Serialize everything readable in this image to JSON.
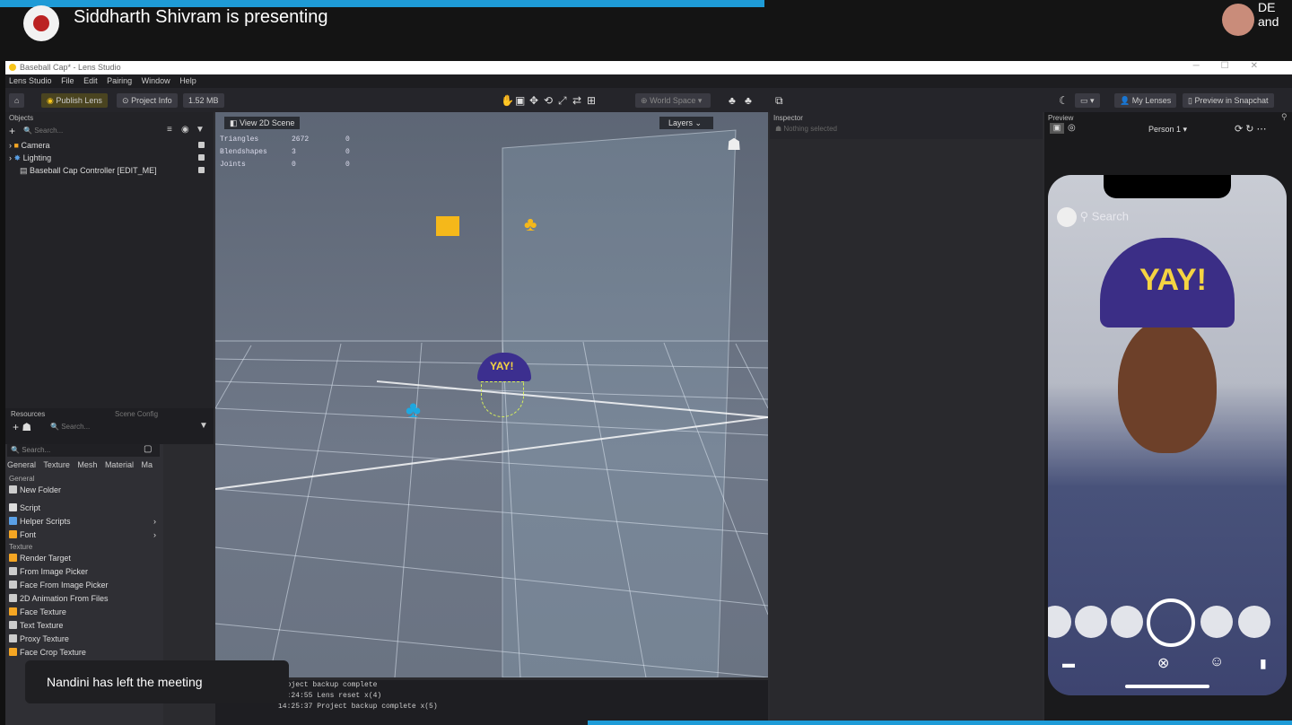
{
  "meeting": {
    "presenter_text": "Siddharth Shivram is presenting",
    "remote_user_label": "and",
    "toast": "Nandini has left the meeting"
  },
  "app": {
    "title": "Baseball Cap* - Lens Studio",
    "menu": [
      "Lens Studio",
      "File",
      "Edit",
      "Pairing",
      "Window",
      "Help"
    ],
    "toolbar": {
      "publish": "Publish Lens",
      "project_info": "Project Info",
      "size": "1.52 MB",
      "world_space": "World Space",
      "my_lenses": "My Lenses",
      "preview_snapchat": "Preview in Snapchat"
    }
  },
  "objects": {
    "title": "Objects",
    "search_placeholder": "Search...",
    "items": [
      {
        "label": "Camera"
      },
      {
        "label": "Lighting"
      },
      {
        "label": "Baseball Cap Controller [EDIT_ME]"
      }
    ]
  },
  "resources": {
    "tab": "Resources",
    "tab2": "Scene Config",
    "search_placeholder": "Search...",
    "popup_search": "Search...",
    "tabs": [
      "General",
      "Texture",
      "Mesh",
      "Material",
      "Ma"
    ],
    "general_section": "General",
    "new_folder": "New Folder",
    "script": "Script",
    "helper_scripts": "Helper Scripts",
    "font": "Font",
    "texture_section": "Texture",
    "textures": [
      "Render Target",
      "From Image Picker",
      "Face From Image Picker",
      "2D Animation From Files",
      "Face Texture",
      "Text Texture",
      "Proxy Texture",
      "Face Crop Texture"
    ]
  },
  "scene": {
    "view2d": "View 2D Scene",
    "layers": "Layers",
    "stats": [
      {
        "name": "Triangles",
        "a": "2672",
        "b": "0"
      },
      {
        "name": "Blendshapes",
        "a": "3",
        "b": "0"
      },
      {
        "name": "Joints",
        "a": "0",
        "b": "0"
      }
    ],
    "cap_text": "YAY!"
  },
  "console": {
    "lines": [
      "Project backup complete",
      "Lens reset x(4)",
      "Project backup complete x(5)"
    ],
    "times": [
      "",
      "14:24:55",
      "14:25:37"
    ]
  },
  "inspector": {
    "title": "Inspector",
    "status": "Nothing selected"
  },
  "preview": {
    "title": "Preview",
    "person": "Person 1",
    "search": "Search",
    "cap_text": "YAY!"
  }
}
